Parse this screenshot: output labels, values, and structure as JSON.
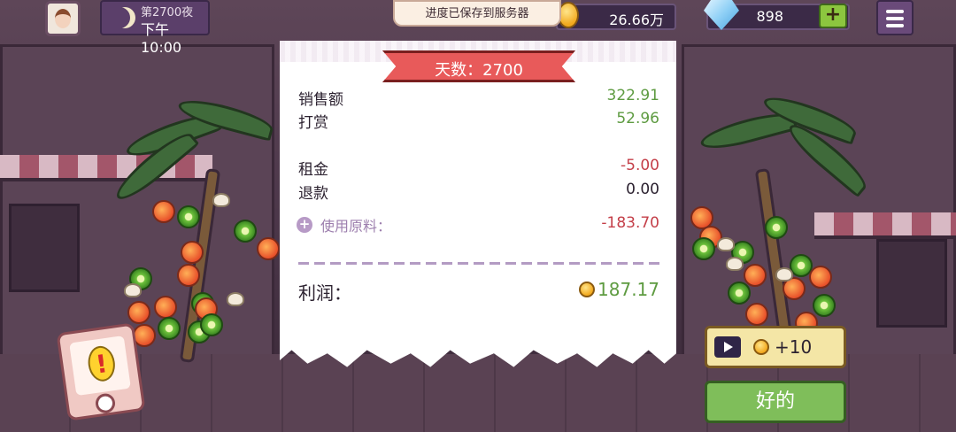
{
  "header": {
    "night": {
      "day_label": "第2700夜",
      "time_label": "下午10:00"
    },
    "save_toast": "进度已保存到服务器",
    "coins": "26.66万",
    "gems": "898",
    "gem_plus": "+"
  },
  "receipt": {
    "day_banner": "天数：2700",
    "rows": [
      {
        "label": "销售额",
        "value": "322.91"
      },
      {
        "label": "打赏",
        "value": "52.96"
      },
      {
        "label": "租金",
        "value": "-5.00"
      },
      {
        "label": "退款",
        "value": "0.00"
      }
    ],
    "ingredients": {
      "icon": "+",
      "label": "使用原料：",
      "value": "-183.70"
    },
    "profit": {
      "label": "利润：",
      "value": "187.17"
    }
  },
  "alert_icon_glyph": "!",
  "actions": {
    "ad_reward": "+10",
    "ok": "好的"
  },
  "colors": {
    "positive": "#5e9b41",
    "negative": "#c43f49",
    "ribbon": "#e85a5a",
    "ok_button": "#7fbe5a"
  }
}
